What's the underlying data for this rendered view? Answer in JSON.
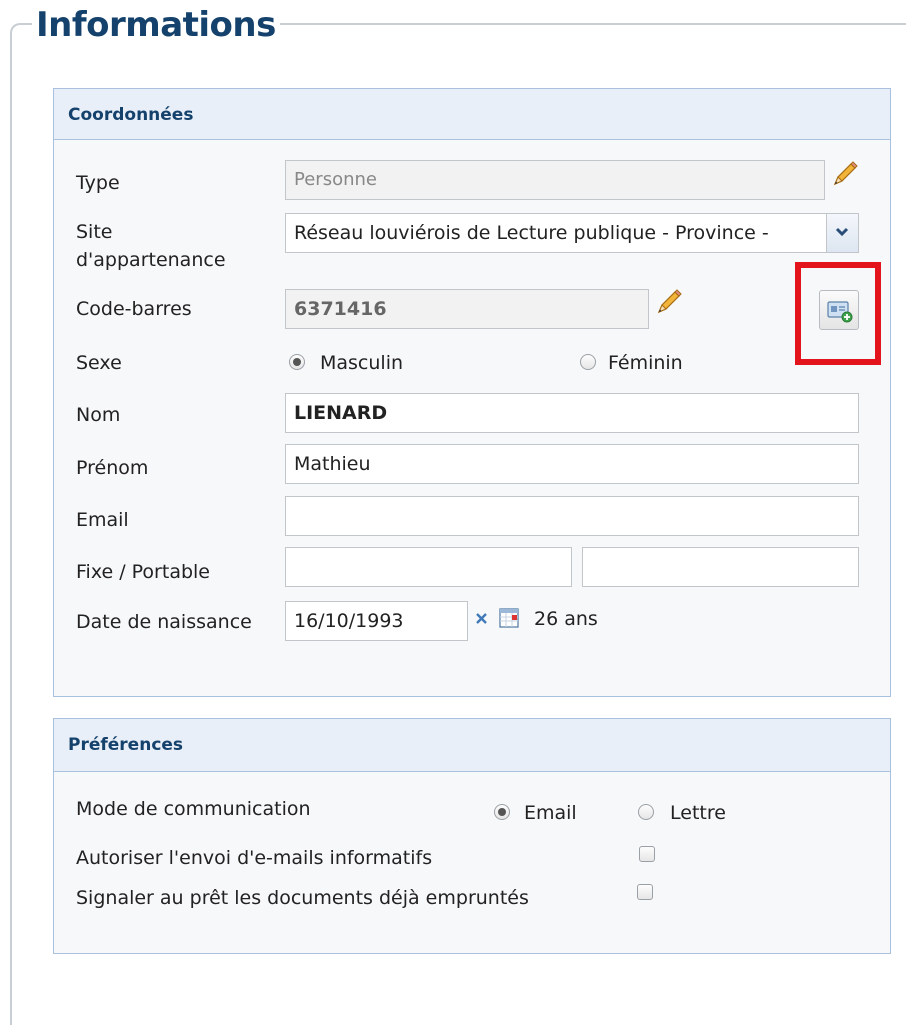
{
  "section_title": "Informations",
  "coordonnees": {
    "header": "Coordonnées",
    "type": {
      "label": "Type",
      "value": "Personne"
    },
    "site": {
      "label_line1": "Site",
      "label_line2": "d'appartenance",
      "value": "Réseau louviérois de Lecture publique - Province -"
    },
    "barcode": {
      "label": "Code-barres",
      "value": "6371416"
    },
    "sexe": {
      "label": "Sexe",
      "options": [
        "Masculin",
        "Féminin"
      ],
      "selected": "Masculin"
    },
    "nom": {
      "label": "Nom",
      "value": "LIENARD"
    },
    "prenom": {
      "label": "Prénom",
      "value": "Mathieu"
    },
    "email": {
      "label": "Email",
      "value": ""
    },
    "phones": {
      "label": "Fixe / Portable",
      "fixe": "",
      "portable": ""
    },
    "birth": {
      "label": "Date de naissance",
      "value": "16/10/1993",
      "age": "26 ans"
    }
  },
  "preferences": {
    "header": "Préférences",
    "mode": {
      "label": "Mode de communication",
      "options": [
        "Email",
        "Lettre"
      ],
      "selected": "Email"
    },
    "autoriser": {
      "label": "Autoriser l'envoi d'e-mails informatifs",
      "checked": false
    },
    "signaler": {
      "label": "Signaler au prêt les documents déjà empruntés",
      "checked": false
    }
  },
  "colors": {
    "title": "#15426c",
    "panel_border": "#a9c1de",
    "highlight": "#e3141b"
  },
  "icons": [
    "pencil-icon",
    "chevron-down-icon",
    "id-card-add-icon",
    "clear-x-icon",
    "calendar-icon"
  ]
}
